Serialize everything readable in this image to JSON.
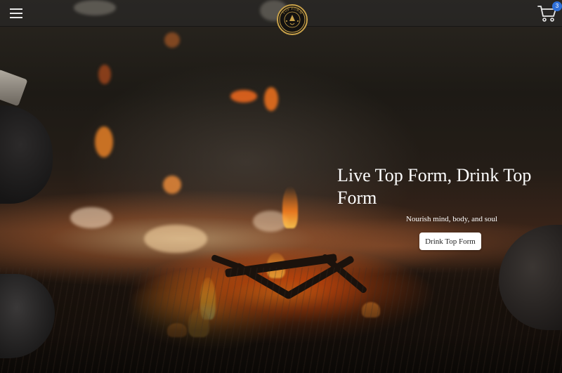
{
  "header": {
    "menu_icon": "hamburger-menu-icon",
    "logo_icon": "top-form-brand-logo",
    "logo_text": "TOP FORM",
    "cart_icon": "shopping-cart-icon",
    "cart_count": "3",
    "bar_color": "#2a2a2a",
    "badge_color": "#2e6fd8"
  },
  "hero": {
    "title": "Live Top Form, Drink Top Form",
    "subtitle": "Nourish mind, body, and soul",
    "cta_label": "Drink Top Form",
    "text_color": "#ffffff",
    "button_color": "#ffffff"
  }
}
